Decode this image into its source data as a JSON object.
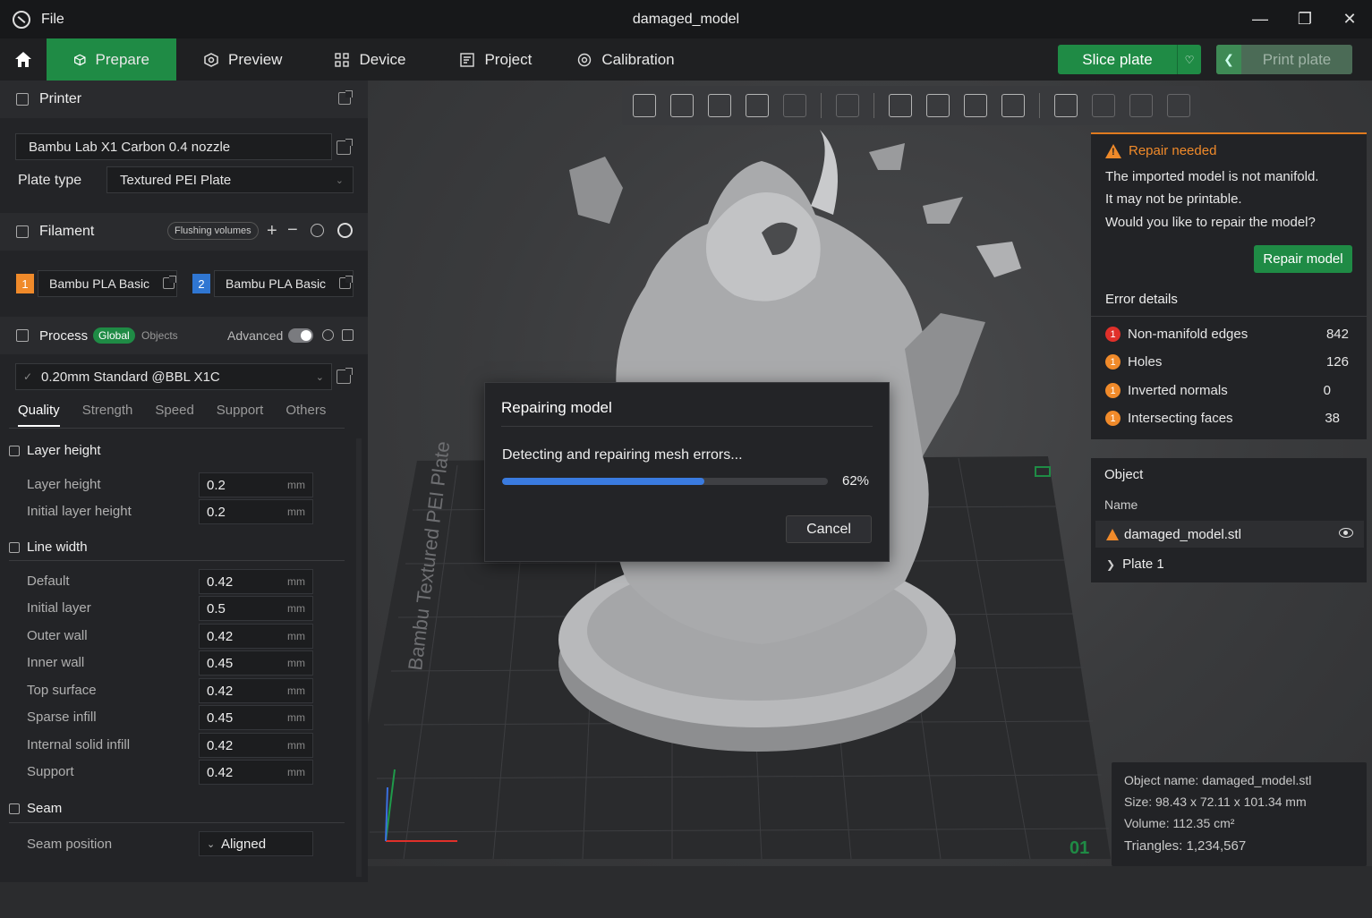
{
  "window": {
    "menu_file": "File",
    "title": "damaged_model"
  },
  "nav": {
    "tabs": [
      {
        "label": "Prepare"
      },
      {
        "label": "Preview"
      },
      {
        "label": "Device"
      },
      {
        "label": "Project"
      },
      {
        "label": "Calibration"
      }
    ],
    "slice_label": "Slice plate",
    "print_label": "Print plate"
  },
  "printer": {
    "section_title": "Printer",
    "model": "Bambu Lab X1 Carbon 0.4 nozzle",
    "plate_type_label": "Plate type",
    "plate_type_value": "Textured PEI Plate"
  },
  "filament": {
    "section_title": "Filament",
    "flushing_label": "Flushing volumes",
    "items": [
      {
        "num": "1",
        "name": "Bambu PLA Basic",
        "color": "#f08a2a"
      },
      {
        "num": "2",
        "name": "Bambu PLA Basic",
        "color": "#2f76d2"
      }
    ]
  },
  "process": {
    "section_title": "Process",
    "global_label": "Global",
    "objects_label": "Objects",
    "advanced_label": "Advanced",
    "preset": "0.20mm Standard @BBL X1C",
    "tabs": [
      "Quality",
      "Strength",
      "Speed",
      "Support",
      "Others"
    ],
    "groups": {
      "layer_height": {
        "title": "Layer height",
        "rows": [
          {
            "label": "Layer height",
            "value": "0.2",
            "unit": "mm"
          },
          {
            "label": "Initial layer height",
            "value": "0.2",
            "unit": "mm"
          }
        ]
      },
      "line_width": {
        "title": "Line width",
        "rows": [
          {
            "label": "Default",
            "value": "0.42",
            "unit": "mm"
          },
          {
            "label": "Initial layer",
            "value": "0.5",
            "unit": "mm"
          },
          {
            "label": "Outer wall",
            "value": "0.42",
            "unit": "mm"
          },
          {
            "label": "Inner wall",
            "value": "0.45",
            "unit": "mm"
          },
          {
            "label": "Top surface",
            "value": "0.42",
            "unit": "mm"
          },
          {
            "label": "Sparse infill",
            "value": "0.45",
            "unit": "mm"
          },
          {
            "label": "Internal solid infill",
            "value": "0.42",
            "unit": "mm"
          },
          {
            "label": "Support",
            "value": "0.42",
            "unit": "mm"
          }
        ]
      },
      "seam": {
        "title": "Seam",
        "rows": [
          {
            "label": "Seam position",
            "value": "Aligned"
          }
        ]
      }
    }
  },
  "repair": {
    "title": "Repair needed",
    "messages": [
      "The imported model is not manifold.",
      "It may not be printable.",
      "Would you like to repair the model?"
    ],
    "button": "Repair model",
    "errors_title": "Error details",
    "errors": [
      {
        "badge": "1",
        "label": "Non-manifold edges",
        "count": "842",
        "color": "#e0302a"
      },
      {
        "badge": "1",
        "label": "Holes",
        "count": "126",
        "color": "#f08a2a"
      },
      {
        "badge": "1",
        "label": "Inverted normals",
        "count": "0",
        "color": "#f08a2a"
      },
      {
        "badge": "1",
        "label": "Intersecting faces",
        "count": "38",
        "color": "#f08a2a"
      }
    ]
  },
  "object_panel": {
    "title": "Object",
    "name_header": "Name",
    "object_name": "damaged_model.stl",
    "plate": "Plate 1"
  },
  "info": {
    "name": "Object name: damaged_model.stl",
    "size": "Size: 98.43 x 72.11 x 101.34 mm",
    "volume": "Volume: 112.35 cm²",
    "triangles": "Triangles: 1,234,567"
  },
  "bed": {
    "label": "Bambu Textured PEI Plate",
    "plate_number": "01"
  },
  "dialog": {
    "title": "Repairing model",
    "message": "Detecting and repairing mesh errors...",
    "progress": 0.62,
    "progress_text": "62%",
    "cancel": "Cancel"
  }
}
